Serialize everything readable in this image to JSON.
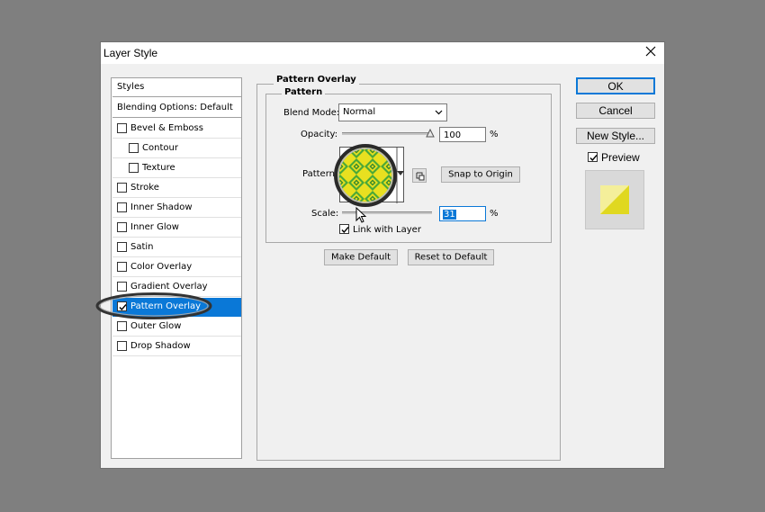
{
  "dialog": {
    "title": "Layer Style"
  },
  "list": {
    "styles_header": "Styles",
    "blending": "Blending Options: Default",
    "items": [
      {
        "label": "Bevel & Emboss",
        "checked": false
      },
      {
        "label": "Contour",
        "checked": false
      },
      {
        "label": "Texture",
        "checked": false
      },
      {
        "label": "Stroke",
        "checked": false
      },
      {
        "label": "Inner Shadow",
        "checked": false
      },
      {
        "label": "Inner Glow",
        "checked": false
      },
      {
        "label": "Satin",
        "checked": false
      },
      {
        "label": "Color Overlay",
        "checked": false
      },
      {
        "label": "Gradient Overlay",
        "checked": false
      },
      {
        "label": "Pattern Overlay",
        "checked": true
      },
      {
        "label": "Outer Glow",
        "checked": false
      },
      {
        "label": "Drop Shadow",
        "checked": false
      }
    ]
  },
  "panel": {
    "outer_label": "Pattern Overlay",
    "inner_label": "Pattern",
    "blend_mode_label": "Blend Mode:",
    "blend_mode_value": "Normal",
    "opacity_label": "Opacity:",
    "opacity_value": "100",
    "opacity_unit": "%",
    "pattern_label": "Pattern",
    "snap_button": "Snap to Origin",
    "scale_label": "Scale:",
    "scale_value": "31",
    "scale_unit": "%",
    "link_label": "Link with Layer",
    "link_checked": true,
    "make_default": "Make Default",
    "reset_default": "Reset to Default"
  },
  "actions": {
    "ok": "OK",
    "cancel": "Cancel",
    "new_style": "New Style...",
    "preview_label": "Preview",
    "preview_checked": true
  },
  "colors": {
    "selection": "#0a78d7",
    "pattern_yellow": "#e8e020",
    "pattern_green": "#4aa838",
    "preview_yellow": "#e8e030"
  }
}
